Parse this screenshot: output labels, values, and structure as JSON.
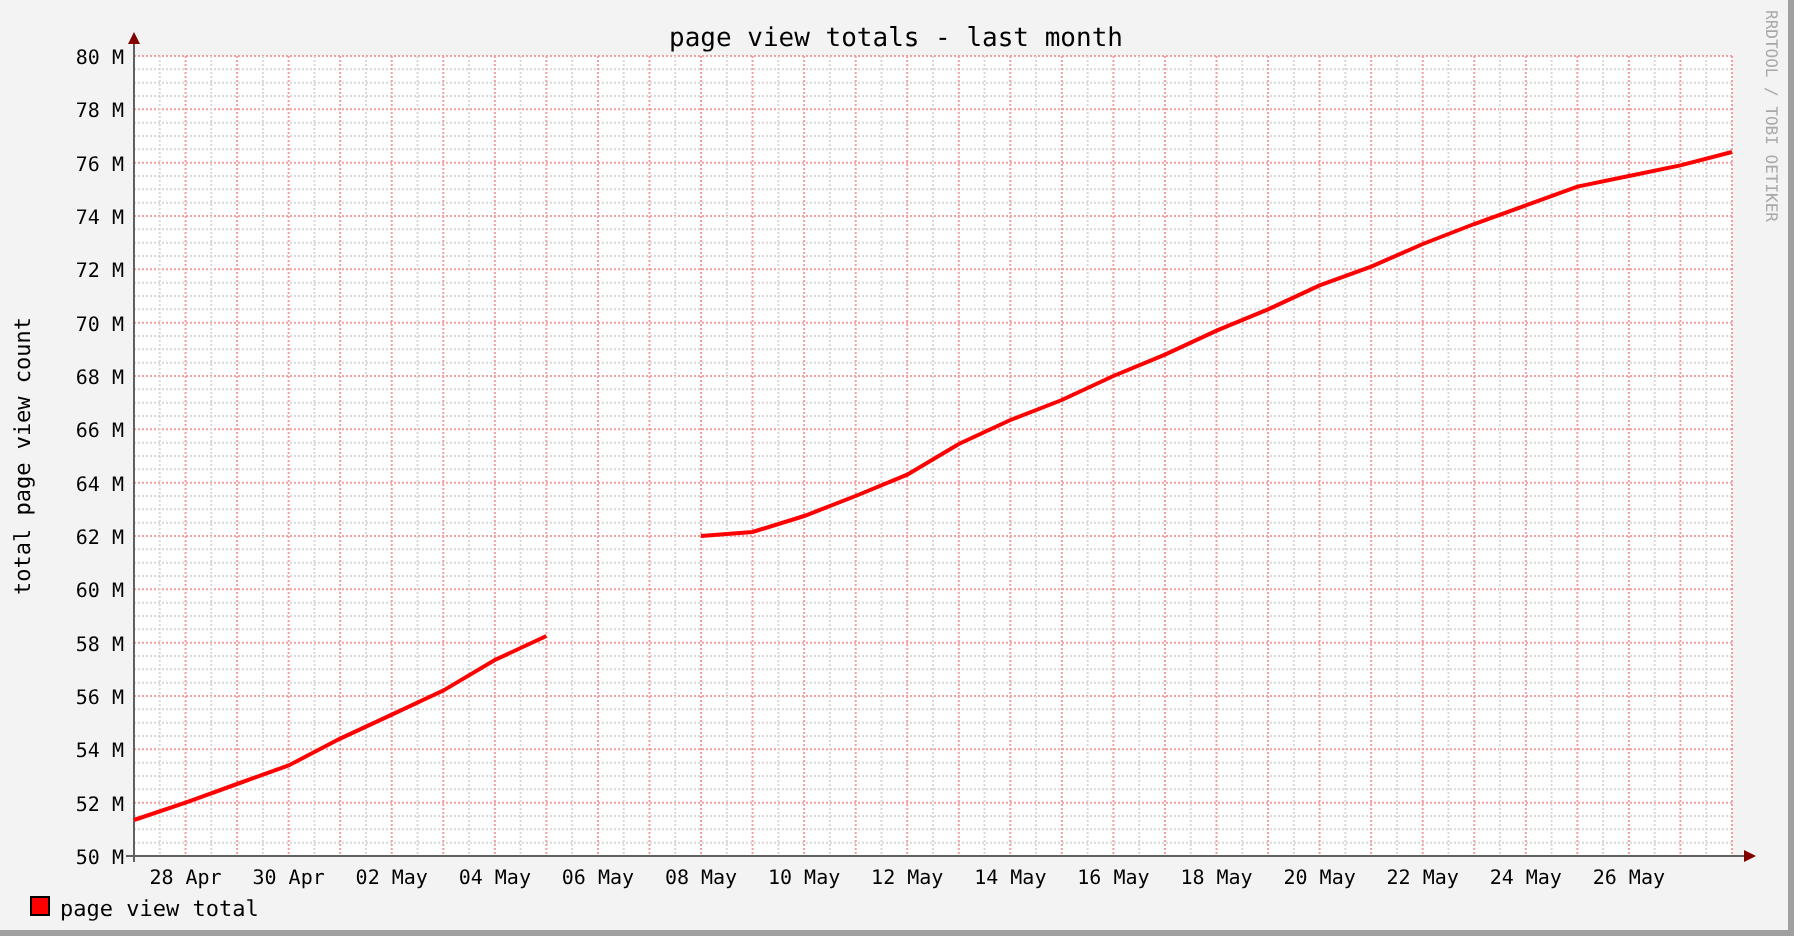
{
  "chart": {
    "credit": "RRDTOOL / TOBI OETIKER",
    "chart_data": {
      "type": "line",
      "title": "page view totals - last month",
      "ylabel": "total page view count",
      "categories": [
        null,
        "28 Apr",
        null,
        "30 Apr",
        null,
        "02 May",
        null,
        "04 May",
        null,
        "06 May",
        null,
        "08 May",
        null,
        "10 May",
        null,
        "12 May",
        null,
        "14 May",
        null,
        "16 May",
        null,
        "18 May",
        null,
        "20 May",
        null,
        "22 May",
        null,
        "24 May",
        null,
        "26 May",
        null,
        null
      ],
      "series": [
        {
          "name": "page view total",
          "color": "#ff0000",
          "values": [
            51.35,
            52.0,
            52.7,
            53.4,
            54.4,
            55.3,
            56.2,
            57.35,
            58.25,
            null,
            null,
            62.0,
            62.15,
            62.75,
            63.5,
            64.3,
            65.45,
            66.35,
            67.1,
            68.0,
            68.8,
            69.7,
            70.5,
            71.4,
            72.1,
            72.95,
            73.7,
            74.4,
            75.1,
            75.5,
            75.9,
            76.4
          ]
        }
      ],
      "grid": true,
      "ylim": [
        50,
        80
      ],
      "yticks": [
        {
          "value": 50,
          "label": "50 M"
        },
        {
          "value": 52,
          "label": "52 M"
        },
        {
          "value": 54,
          "label": "54 M"
        },
        {
          "value": 56,
          "label": "56 M"
        },
        {
          "value": 58,
          "label": "58 M"
        },
        {
          "value": 60,
          "label": "60 M"
        },
        {
          "value": 62,
          "label": "62 M"
        },
        {
          "value": 64,
          "label": "64 M"
        },
        {
          "value": 66,
          "label": "66 M"
        },
        {
          "value": 68,
          "label": "68 M"
        },
        {
          "value": 70,
          "label": "70 M"
        },
        {
          "value": 72,
          "label": "72 M"
        },
        {
          "value": 74,
          "label": "74 M"
        },
        {
          "value": 76,
          "label": "76 M"
        },
        {
          "value": 78,
          "label": "78 M"
        },
        {
          "value": 80,
          "label": "80 M"
        }
      ]
    }
  }
}
